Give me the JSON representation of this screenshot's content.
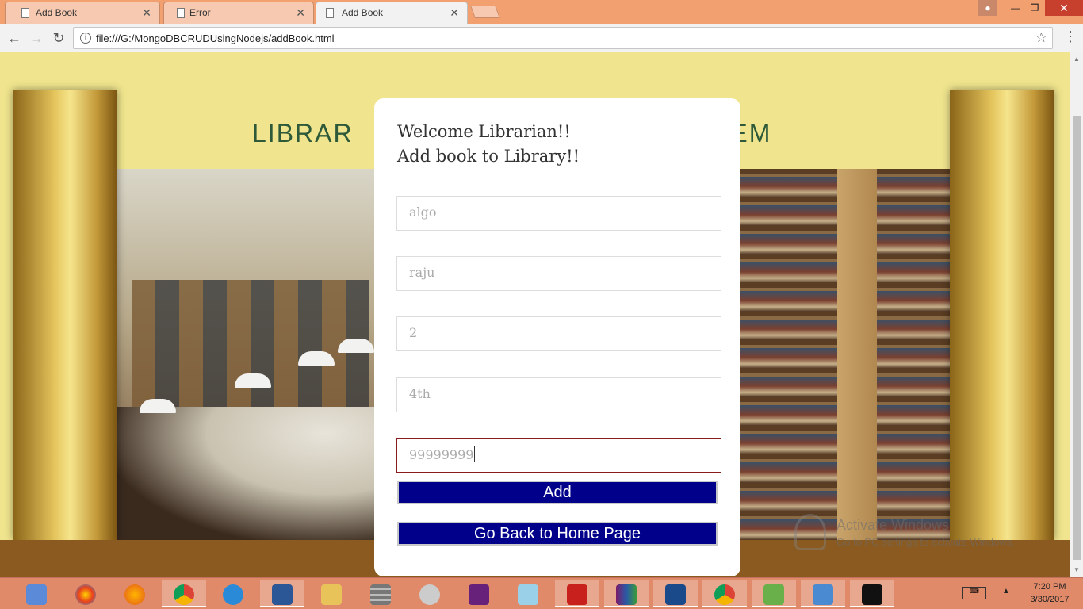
{
  "browser": {
    "tabs": [
      {
        "title": "Add Book",
        "active": false
      },
      {
        "title": "Error",
        "active": false
      },
      {
        "title": "Add Book",
        "active": true
      }
    ],
    "url": "file:///G:/MongoDBCRUDUsingNodejs/addBook.html"
  },
  "page": {
    "banner_left": "LIBRAR",
    "banner_right": "STEM",
    "card": {
      "heading_line1": "Welcome Librarian!!",
      "heading_line2": "Add book to Library!!",
      "fields": [
        "algo",
        "raju",
        "2",
        "4th",
        "99999999"
      ],
      "add_button": "Add",
      "home_button": "Go Back to Home Page"
    },
    "watermark": {
      "title": "Activate Windows",
      "subtitle": "Go to PC settings to activate Windows."
    }
  },
  "taskbar": {
    "time": "7:20 PM",
    "date": "3/30/2017",
    "apps": [
      "media-player-icon",
      "photos-icon",
      "firefox-icon",
      "chrome-icon",
      "ie-icon",
      "word-icon",
      "file-explorer-icon",
      "wall-icon",
      "git-icon",
      "visual-studio-icon",
      "notebook-icon",
      "acrobat-icon",
      "winrar-icon",
      "brackets-icon",
      "chrome-icon",
      "chart-icon",
      "wordpad-icon",
      "cmd-icon"
    ]
  },
  "colors": {
    "button_bg": "#00008b",
    "page_bg": "#f0e58e",
    "focus_border": "#8b1a1a"
  }
}
